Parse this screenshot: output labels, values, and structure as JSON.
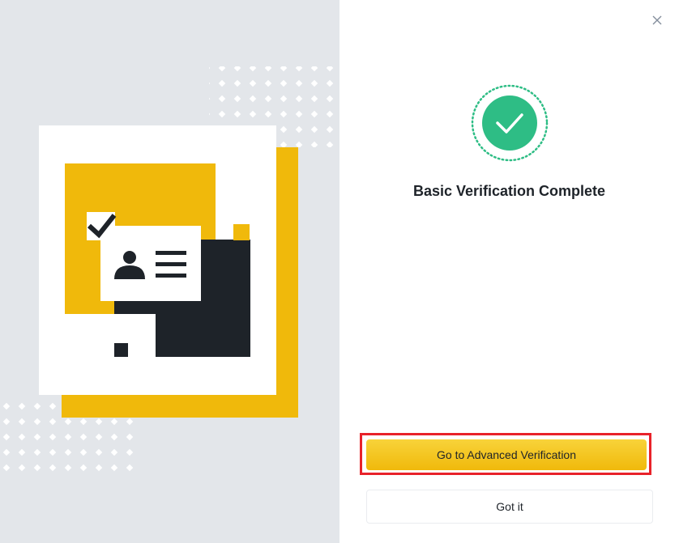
{
  "modal": {
    "title": "Basic Verification Complete",
    "primary_button": "Go to Advanced Verification",
    "secondary_button": "Got it",
    "close_icon": "close-icon",
    "status_icon": "check-circle-icon"
  },
  "illustration": {
    "icon": "id-card-verified-illustration"
  },
  "colors": {
    "accent": "#f0b90b",
    "success": "#2ebd85",
    "text": "#1e2329",
    "highlight_border": "#e8222a"
  }
}
